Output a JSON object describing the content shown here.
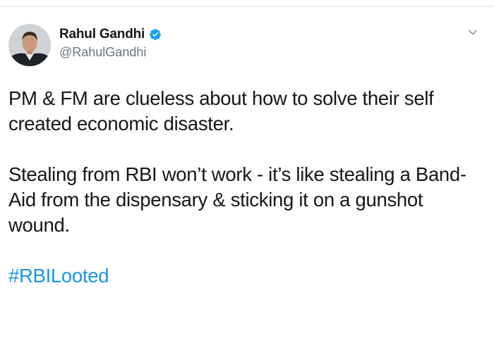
{
  "author": {
    "display_name": "Rahul Gandhi",
    "handle": "@RahulGandhi",
    "verified": true
  },
  "icons": {
    "verified": "verified-badge-icon",
    "menu": "chevron-down-icon"
  },
  "tweet": {
    "paragraph_1": "PM & FM are clueless about how to solve their self created economic disaster.",
    "paragraph_2": "Stealing from RBI won’t work - it’s like stealing a Band-Aid from the dispensary & sticking it on a gunshot wound.",
    "hashtag": "#RBILooted"
  },
  "colors": {
    "link": "#1b95e0",
    "verified": "#1da1f2",
    "secondary_text": "#657786",
    "primary_text": "#14171a"
  }
}
